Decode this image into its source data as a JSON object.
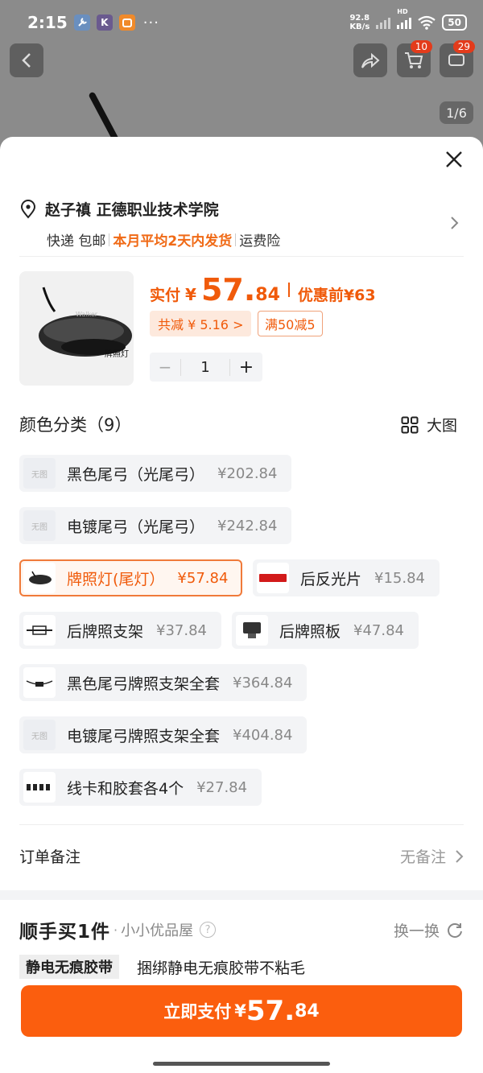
{
  "status_bar": {
    "time": "2:15",
    "net_speed_value": "92.8",
    "net_speed_unit": "KB/s",
    "hd_label": "HD",
    "battery": "50"
  },
  "top_bar": {
    "cart_badge": "10",
    "messages_badge": "29",
    "pager": "1/6"
  },
  "address": {
    "name": "赵子禛 正德职业技术学院",
    "shipping": "快递 包邮",
    "delivery": "本月平均2天内发货",
    "insurance": "运费险"
  },
  "product": {
    "thumb_label": "牌照灯",
    "thumb_brand": "Walker",
    "price_label": "实付",
    "currency": "¥",
    "price_int": "57.",
    "price_dec": "84",
    "orig_price": "优惠前¥63",
    "discount": "共减 ¥ 5.16 >",
    "promo": "满50减5",
    "qty_minus": "−",
    "quantity": "1",
    "qty_plus": "+"
  },
  "variants": {
    "title": "颜色分类（9）",
    "big_view": "大图",
    "no_image_label": "无图",
    "items": [
      {
        "name": "黑色尾弓（光尾弓）",
        "price": "¥202.84"
      },
      {
        "name": "电镀尾弓（光尾弓）",
        "price": "¥242.84"
      },
      {
        "name": "牌照灯(尾灯）",
        "price": "¥57.84"
      },
      {
        "name": "后反光片",
        "price": "¥15.84"
      },
      {
        "name": "后牌照支架",
        "price": "¥37.84"
      },
      {
        "name": "后牌照板",
        "price": "¥47.84"
      },
      {
        "name": "黑色尾弓牌照支架全套",
        "price": "¥364.84"
      },
      {
        "name": "电镀尾弓牌照支架全套",
        "price": "¥404.84"
      },
      {
        "name": "线卡和胶套各4个",
        "price": "¥27.84"
      }
    ],
    "selected_index": 2
  },
  "order_note": {
    "label": "订单备注",
    "value": "无备注"
  },
  "addon": {
    "brand": "顺手买1件",
    "dot": "·",
    "shop": "小小优品屋",
    "help": "?",
    "swap": "换一换",
    "tag": "静电无痕胶带",
    "desc": "捆绑静电无痕胶带不粘毛"
  },
  "pay": {
    "label": "立即支付",
    "currency": "¥",
    "amount_int": "57.",
    "amount_dec": "84"
  },
  "colors": {
    "accent": "#fb5e0e",
    "price": "#f05a0a"
  }
}
